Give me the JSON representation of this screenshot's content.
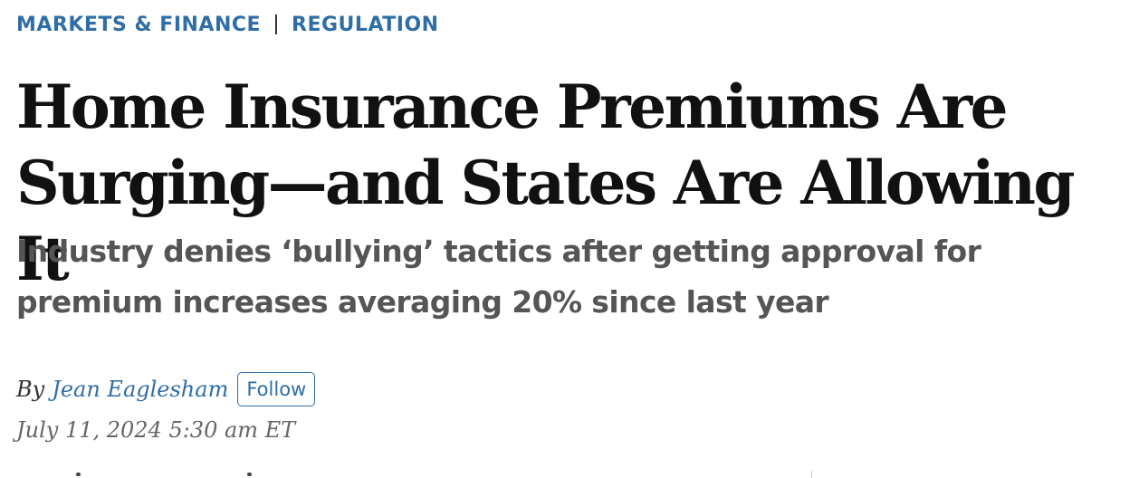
{
  "article": {
    "kickers": {
      "section": "MARKETS & FINANCE",
      "subsection": "REGULATION"
    },
    "headline": "Home Insurance Premiums Are Surging—and States Are Allowing It",
    "dek": "Industry denies ‘bullying’ tactics after getting approval for premium increases averaging 20% since last year",
    "byline": {
      "prefix": "By",
      "author": "Jean Eaglesham",
      "follow_label": "Follow"
    },
    "timestamp": "July 11, 2024 5:30 am ET"
  },
  "colors": {
    "link_blue": "#2f6ea4",
    "headline": "#111111",
    "dek_gray": "#555555",
    "timestamp_gray": "#666666"
  }
}
